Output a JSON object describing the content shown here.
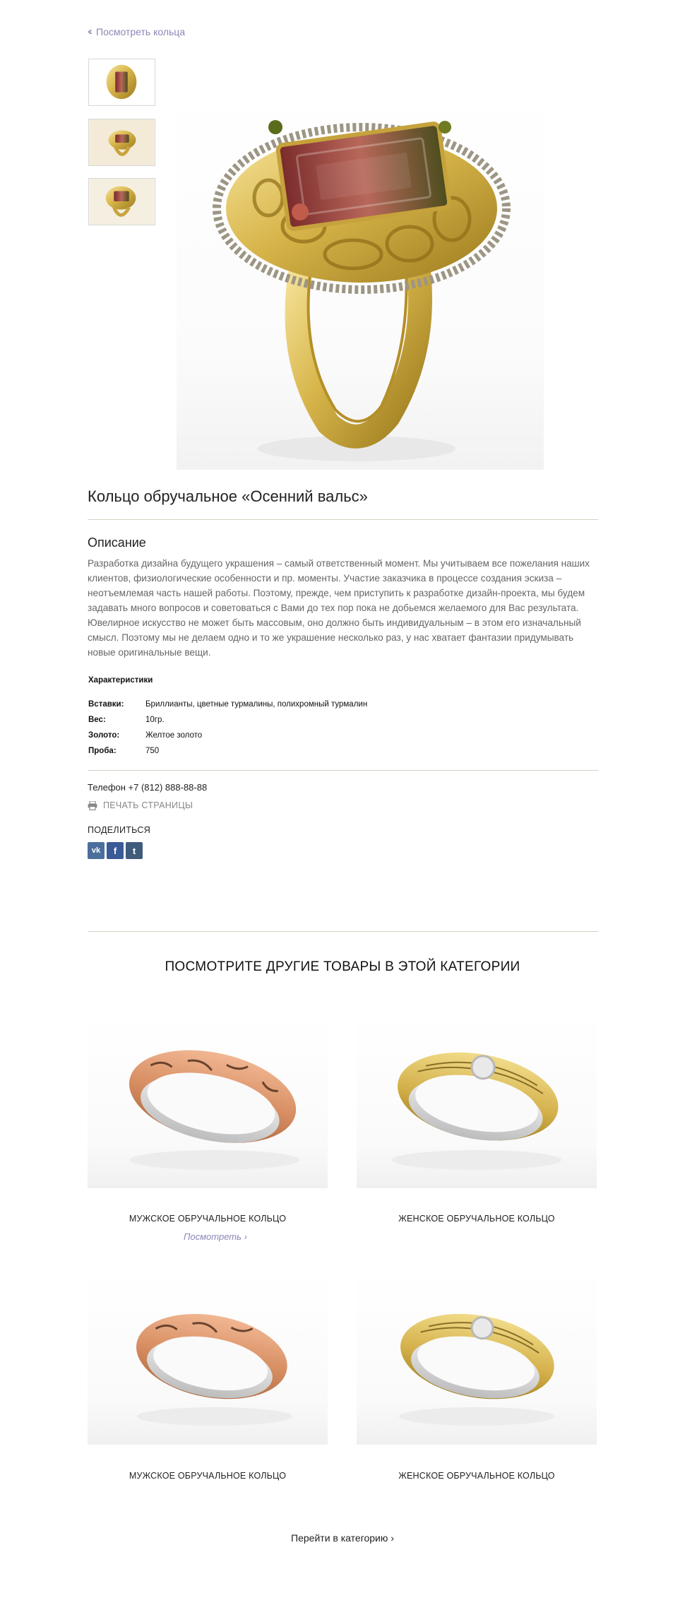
{
  "nav": {
    "back_label": "Посмотреть кольца",
    "back_icon": "double-chevron-left-icon"
  },
  "gallery": {
    "thumbnails": [
      {
        "name": "ring-top-view"
      },
      {
        "name": "ring-side-view"
      },
      {
        "name": "ring-angle-view"
      }
    ]
  },
  "product": {
    "title": "Кольцо обручальное «Осенний вальс»",
    "description_title": "Описание",
    "description": "Разработка дизайна будущего украшения – самый ответственный момент. Мы учитываем все пожелания наших клиентов, физиологические особенности и пр. моменты. Участие заказчика в процессе создания эскиза – неотъемлемая часть нашей работы. Поэтому, прежде, чем приступить  к разработке дизайн-проекта, мы будем задавать много вопросов и советоваться с Вами до тех пор пока не добьемся желаемого для Вас результата. Ювелирное искусство не может быть массовым, оно должно быть индивидуальным – в этом его изначальный смысл. Поэтому мы не делаем одно и то же украшение несколько раз, у нас хватает фантазии придумывать новые оригинальные вещи.",
    "characteristics_title": "Характеристики",
    "characteristics": [
      {
        "key": "Вставки:",
        "value": "Бриллианты, цветные турмалины, полихромный турмалин"
      },
      {
        "key": "Вес:",
        "value": "10гр."
      },
      {
        "key": "Золото:",
        "value": "Желтое золото"
      },
      {
        "key": "Проба:",
        "value": "750"
      }
    ],
    "phone": "Телефон +7 (812) 888-88-88",
    "print_label": "ПЕЧАТЬ СТРАНИЦЫ",
    "share_label": "ПОДЕЛИТЬСЯ",
    "social": [
      {
        "label": "vk",
        "icon": "vk-icon",
        "color": "#4a6f9c"
      },
      {
        "label": "f",
        "icon": "facebook-icon",
        "color": "#3b5a98"
      },
      {
        "label": "t",
        "icon": "tumblr-icon",
        "color": "#3f5c7c"
      }
    ]
  },
  "related": {
    "title": "ПОСМОТРИТЕ ДРУГИЕ ТОВАРЫ В ЭТОЙ КАТЕГОРИИ",
    "items": [
      {
        "name": "МУЖСКОЕ ОБРУЧАЛЬНОЕ КОЛЬЦО",
        "metal": "rose"
      },
      {
        "name": "ЖЕНСКОЕ ОБРУЧАЛЬНОЕ КОЛЬЦО",
        "metal": "yellow"
      },
      {
        "name": "МУЖСКОЕ ОБРУЧАЛЬНОЕ КОЛЬЦО",
        "metal": "rose"
      },
      {
        "name": "ЖЕНСКОЕ ОБРУЧАЛЬНОЕ КОЛЬЦО",
        "metal": "yellow"
      }
    ],
    "view_label": "Посмотреть",
    "category_link": "Перейти в категорию"
  },
  "colors": {
    "accent": "#8a87b8",
    "divider": "#d6cfc3",
    "text_muted": "#666666"
  }
}
